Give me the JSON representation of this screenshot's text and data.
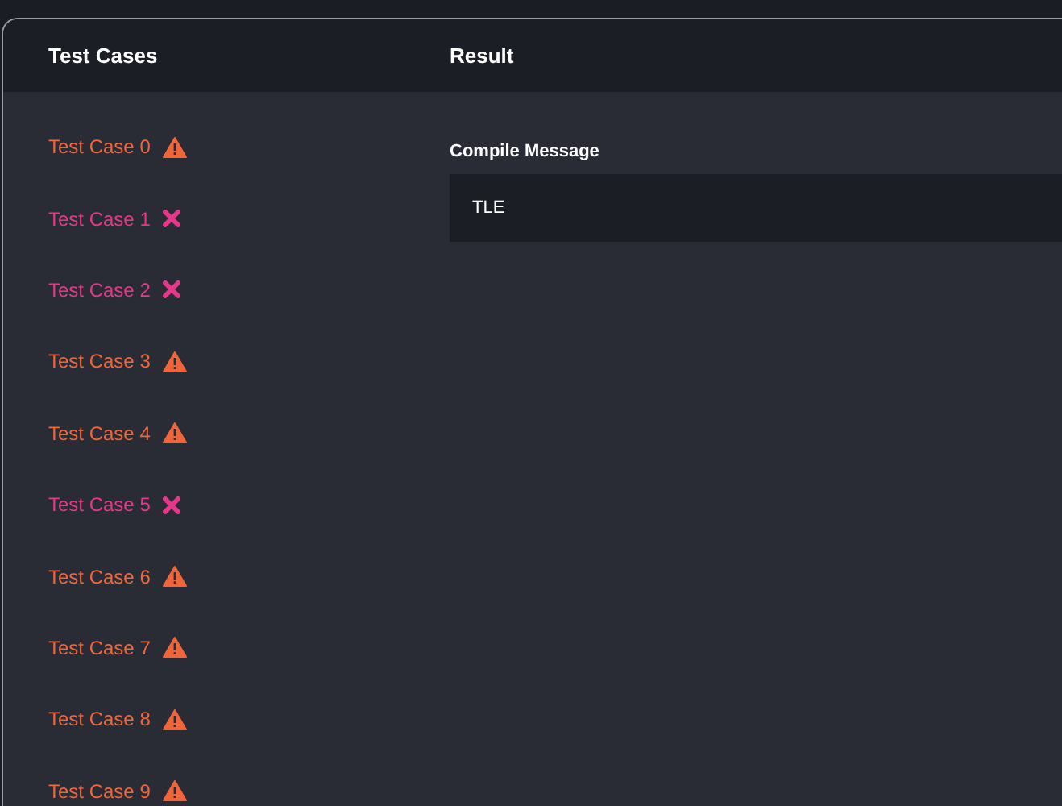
{
  "headers": {
    "test_cases": "Test Cases",
    "result": "Result"
  },
  "test_cases": [
    {
      "label": "Test Case 0",
      "kind": "warning"
    },
    {
      "label": "Test Case 1",
      "kind": "wrong"
    },
    {
      "label": "Test Case 2",
      "kind": "wrong"
    },
    {
      "label": "Test Case 3",
      "kind": "warning"
    },
    {
      "label": "Test Case 4",
      "kind": "warning"
    },
    {
      "label": "Test Case 5",
      "kind": "wrong"
    },
    {
      "label": "Test Case 6",
      "kind": "warning"
    },
    {
      "label": "Test Case 7",
      "kind": "warning"
    },
    {
      "label": "Test Case 8",
      "kind": "warning"
    },
    {
      "label": "Test Case 9",
      "kind": "warning"
    }
  ],
  "compile_message": {
    "label": "Compile Message",
    "text": "TLE"
  }
}
